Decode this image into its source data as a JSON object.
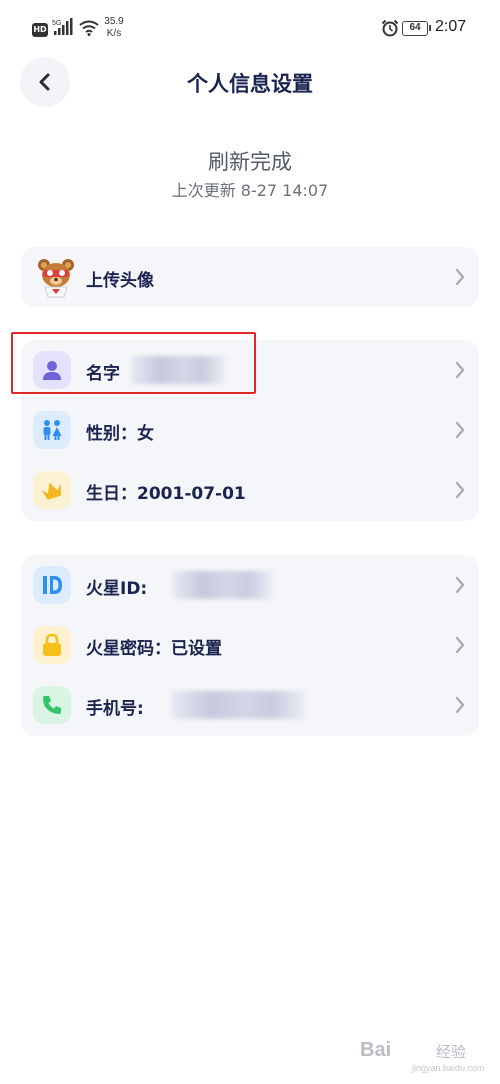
{
  "status_bar": {
    "hd": "HD",
    "net": "5G",
    "speed": "35.9 K/s",
    "battery": "64",
    "time": "2:07"
  },
  "header": {
    "title": "个人信息设置",
    "back_icon": "chevron-left-icon"
  },
  "refresh": {
    "title": "刷新完成",
    "subtitle": "上次更新 8-27 14:07"
  },
  "avatar_card": {
    "label": "上传头像",
    "icon": "avatar-bear-icon"
  },
  "profile_card": {
    "items": [
      {
        "label": "名字",
        "icon": "person-icon",
        "color": "#6e63d9",
        "bg": "#e3e1fb"
      },
      {
        "label": "性别：女",
        "icon": "gender-icon",
        "color": "#2e8ff0",
        "bg": "#dcecfd"
      },
      {
        "label": "生日：2001-07-01",
        "icon": "crown-icon",
        "color": "#f4b81f",
        "bg": "#fdf1d4"
      }
    ]
  },
  "account_card": {
    "items": [
      {
        "label": "火星ID:",
        "icon": "id-icon",
        "color": "#2e8ff0",
        "bg": "#dcecfd"
      },
      {
        "label": "火星密码：已设置",
        "icon": "lock-icon",
        "color": "#f4c01a",
        "bg": "#fdf1cf"
      },
      {
        "label": "手机号:",
        "icon": "phone-icon",
        "color": "#35c46a",
        "bg": "#d9f4e2"
      }
    ]
  },
  "watermark": {
    "logo": "Bai",
    "text": "经验",
    "url": "jingyan.baidu.com"
  }
}
